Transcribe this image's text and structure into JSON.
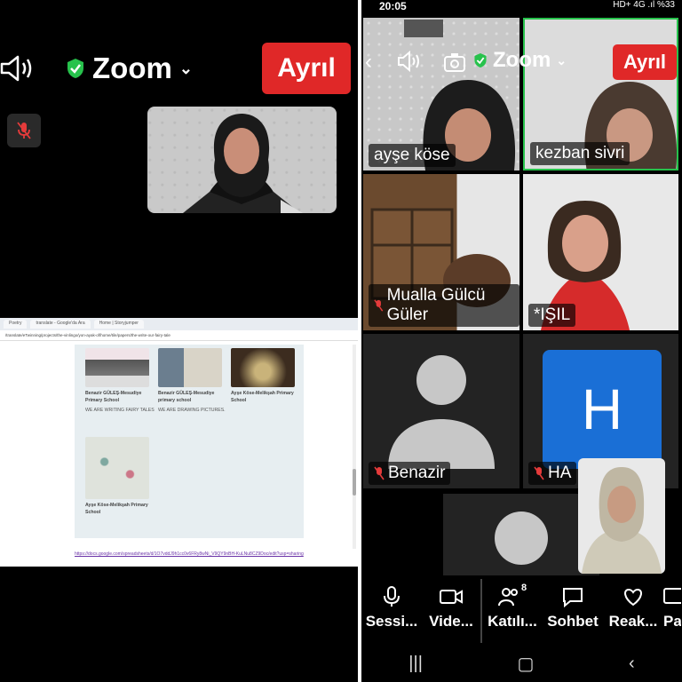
{
  "left": {
    "title": "Zoom",
    "leave_label": "Ayrıl",
    "shared": {
      "tabs": [
        "Poetry",
        "translate - Google'da Ara",
        "Home | Storyjumper"
      ],
      "url": "/translate/eTwinning/projects/the-vinlingo/yon-ayak-of/home/tile/papers/the-write-our-fairy-tale",
      "cards": [
        {
          "caption": "Benazir GÜLEŞ-Mesudiye Primary School",
          "sub": "WE ARE WRITING FAIRY TALES"
        },
        {
          "caption": "Benazir GÜLEŞ-Mesudiye primary school",
          "sub": "WE ARE DRAWING PICTURES."
        },
        {
          "caption": "Ayşe Köse-Melikşah Primary School",
          "sub": ""
        },
        {
          "caption": "Ayşe Köse-Melikşah Primary School",
          "sub": ""
        }
      ],
      "link": "https://docs.google.com/spreadsheets/d/1O7vddJ9h1cc0v6FRy8wNi_V9QY9nBH-KuLNu8CZ9Doc/edit?usp=sharing"
    }
  },
  "right": {
    "status": {
      "time": "20:05",
      "icons": "HD+ 4G .ıl %33"
    },
    "title": "Zoom",
    "leave_label": "Ayrıl",
    "participants": [
      {
        "name": "ayşe köse"
      },
      {
        "name": "kezban sivri"
      },
      {
        "name": "Mualla Gülcü Güler"
      },
      {
        "name": "*IŞIL"
      },
      {
        "name": "Benazir"
      },
      {
        "name": "HA",
        "initial": "H"
      }
    ],
    "toolbar": {
      "mute": "Sessi...",
      "video": "Vide...",
      "participants": "Katılı...",
      "participants_count": "8",
      "chat": "Sohbet",
      "reactions": "Reak...",
      "share": "Pay"
    }
  }
}
